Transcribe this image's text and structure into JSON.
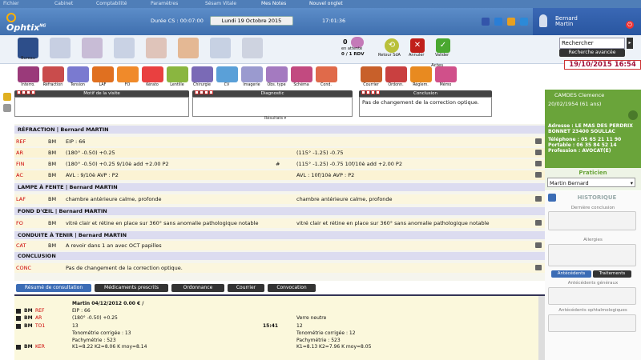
{
  "menu": {
    "items": [
      "Fichier",
      "Cabinet",
      "Comptabilité",
      "Paramètres",
      "Sésam Vitale",
      "Mes Notes",
      "Nouvel onglet"
    ]
  },
  "header": {
    "logo": "Ophtix",
    "logo_sup": "NG",
    "duree": "Durée CS : 00:07:00",
    "date": "Lundi 19 Octobre 2015",
    "time": "17:01:36",
    "user_first": "Bernard",
    "user_last": "Martin"
  },
  "toolbar": {
    "bureau": "Bureau",
    "attente_count": "0",
    "attente_label": "en attente",
    "rdv": "0 / 1 RDV",
    "retour": "Retour SdA",
    "annuler": "Annuler",
    "valider": "Valider",
    "search_placeholder": "Rechercher",
    "search_adv": "Recherche avancée",
    "datestamp": "19/10/2015 16:54"
  },
  "acts": {
    "label": "Actes",
    "items": [
      "Interro.",
      "Réfraction",
      "Tension",
      "LAF",
      "FO",
      "Kérato",
      "Lentille",
      "Chirurgie",
      "CV",
      "Imagerie",
      "Obs. type",
      "Schéma",
      "Cond."
    ],
    "right": [
      "Courrier",
      "Ordonn.",
      "Règlem.",
      "Mémo"
    ]
  },
  "visit": {
    "motif_header": "Motif de la visite",
    "diag_header": "Diagnostic",
    "concl_header": "Conclusion",
    "conclusion_text": "Pas de changement de la correction optique.",
    "resultats": "Résultats"
  },
  "sections": {
    "refraction": "RÉFRACTION | Bernard MARTIN",
    "lampe": "LAMPE À FENTE | Bernard MARTIN",
    "fond": "FOND D'ŒIL | Bernard MARTIN",
    "conduite": "CONDUITE À TENIR | Bernard MARTIN",
    "conclusion": "CONCLUSION"
  },
  "rows": {
    "ref": {
      "code": "REF",
      "bm": "BM",
      "a": "EIP : 66",
      "b": "",
      "mid": ""
    },
    "ar": {
      "code": "AR",
      "bm": "BM",
      "a": "(180° -0.50) +0.25",
      "b": "(115° -1.25) -0.75",
      "mid": ""
    },
    "fin": {
      "code": "FIN",
      "bm": "BM",
      "a": "(180° -0.50) +0.25 9/10è add +2.00 P2",
      "b": "(115° -1.25) -0.75 10f/10è add +2.00 P2",
      "mid": "#"
    },
    "ac": {
      "code": "AC",
      "bm": "BM",
      "a": "AVL : 9/10è AVP : P2",
      "b": "AVL : 10f/10è AVP : P2",
      "mid": ""
    },
    "laf": {
      "code": "LAF",
      "bm": "BM",
      "a": "chambre antérieure calme, profonde",
      "b": "chambre antérieure calme, profonde"
    },
    "fo": {
      "code": "FO",
      "bm": "BM",
      "a": "vitré clair et rétine en place sur 360° sans anomalie pathologique notable",
      "b": "vitré clair et rétine en place sur 360° sans anomalie pathologique notable"
    },
    "cat": {
      "code": "CAT",
      "bm": "BM",
      "a": "A revoir dans 1 an avec OCT papilles"
    },
    "conc": {
      "code": "CONC",
      "a": "Pas de changement de la correction optique."
    }
  },
  "patient": {
    "name": "CAMDES Clemence",
    "dob": "20/02/1954 (61 ans)",
    "adresse": "Adresse : LE MAS DES PERDRIX BONNET 23400 SOULLAC",
    "telephone": "Téléphone : 05 65 21 11 90",
    "portable": "Portable : 06 35 84 52 14",
    "profession": "Profession : AVOCAT(E)"
  },
  "side": {
    "praticien": "Praticien",
    "praticien_value": "Martin Bernard",
    "historique": "HISTORIQUE",
    "derniere": "Dernière conclusion",
    "allergies": "Allergies",
    "antecedents": "Antécédents",
    "traitements": "Traitements",
    "ant_generaux": "Antécédents généraux",
    "ant_ophtalmo": "Antécédents ophtalmologiques"
  },
  "tabs": [
    "Résumé de consultation",
    "Médicaments prescrits",
    "Ordonnance",
    "Courrier",
    "Convocation"
  ],
  "history": {
    "entry_title": "Martin 04/12/2012 0.00 € /",
    "rows": [
      {
        "code": "REF",
        "left": "EIP : 66",
        "right": ""
      },
      {
        "code": "AR",
        "left": "(180° -0.50) +0.25",
        "right": "Verre neutre"
      },
      {
        "code": "TO1",
        "left": "13",
        "mid": "15:41",
        "right": "12"
      },
      {
        "code": "",
        "left": "Tonométrie corrigée : 13",
        "right": "Tonométrie corrigée : 12"
      },
      {
        "code": "",
        "left": "Pachymétrie : 523",
        "right": "Pachymétrie : 523"
      },
      {
        "code": "KER",
        "left": "K1=8.22 K2=8.06 K moy=8.14",
        "right": "K1=8.13 K2=7.96 K moy=8.05"
      }
    ]
  },
  "colors": {
    "accent": "#3b6cb5",
    "green": "#6aa43a",
    "code": "#cc0000",
    "datestamp": "#a0103a"
  }
}
